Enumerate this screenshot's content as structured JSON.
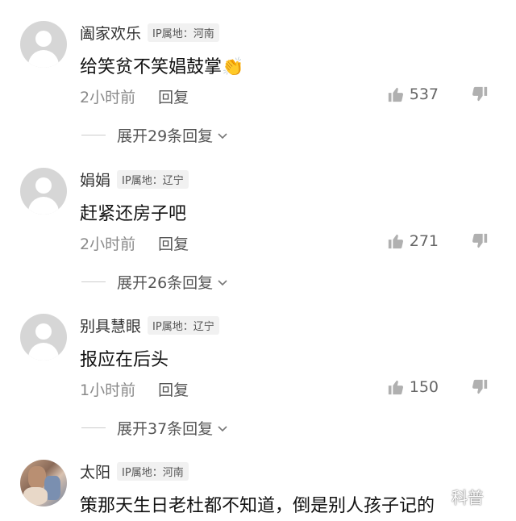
{
  "comments": [
    {
      "username": "阖家欢乐",
      "ip": "IP属地：河南",
      "text": "给笑贫不笑娼鼓掌👏",
      "time": "2小时前",
      "reply": "回复",
      "likes": "537",
      "expand": "展开29条回复"
    },
    {
      "username": "娟娟",
      "ip": "IP属地：辽宁",
      "text": "赶紧还房子吧",
      "time": "2小时前",
      "reply": "回复",
      "likes": "271",
      "expand": "展开26条回复"
    },
    {
      "username": "别具慧眼",
      "ip": "IP属地：辽宁",
      "text": "报应在后头",
      "time": "1小时前",
      "reply": "回复",
      "likes": "150",
      "expand": "展开37条回复"
    },
    {
      "username": "太阳",
      "ip": "IP属地：河南",
      "text": "策那天生日老杜都不知道，倒是别人孩子记的"
    }
  ],
  "watermark": "科普"
}
